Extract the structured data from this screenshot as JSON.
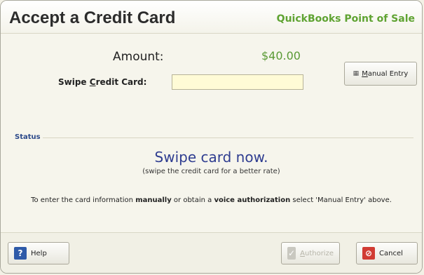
{
  "window": {
    "title": "Accept a Credit Card",
    "brand": "QuickBooks Point of Sale"
  },
  "payment": {
    "amount_label": "Amount:",
    "amount_value": "$40.00",
    "swipe_label_pre": "Swipe ",
    "swipe_label_accel": "C",
    "swipe_label_post": "redit Card:",
    "swipe_value": "",
    "manual_entry_accel": "M",
    "manual_entry_rest": "anual Entry"
  },
  "status": {
    "section_label": "Status",
    "message": "Swipe card now.",
    "hint": "(swipe the credit card for a better rate)",
    "instructions_part1": "To enter the card information ",
    "instructions_bold1": "manually",
    "instructions_part2": " or obtain a ",
    "instructions_bold2": "voice authorization",
    "instructions_part3": " select 'Manual Entry' above."
  },
  "footer": {
    "help_label": "Help",
    "authorize_accel": "A",
    "authorize_rest": "uthorize",
    "cancel_label": "Cancel"
  },
  "icons": {
    "help": "help-icon",
    "authorize": "check-icon",
    "cancel": "cancel-icon",
    "manual_entry": "keypad-icon"
  },
  "colors": {
    "brand_green": "#5fa332",
    "status_blue": "#2f3d90",
    "input_bg": "#fffbd6"
  }
}
